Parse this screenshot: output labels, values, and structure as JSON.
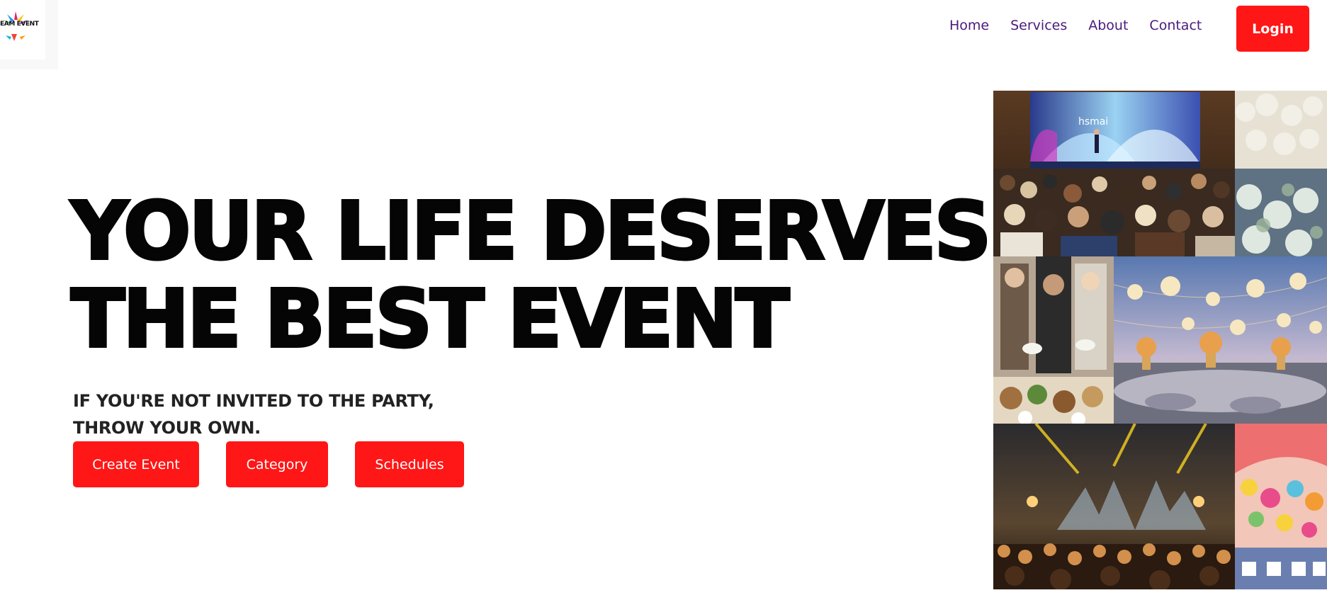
{
  "logo": {
    "text": "EAM EVENT"
  },
  "nav": {
    "items": [
      {
        "label": "Home"
      },
      {
        "label": "Services"
      },
      {
        "label": "About"
      },
      {
        "label": "Contact"
      }
    ],
    "login_label": "Login"
  },
  "hero": {
    "title_line1": "YOUR LIFE DESERVES",
    "title_line2": "THE BEST EVENT",
    "subtitle_line1": "IF YOU'RE NOT INVITED TO THE PARTY,",
    "subtitle_line2": "THROW YOUR OWN.",
    "buttons": [
      {
        "label": "Create Event"
      },
      {
        "label": "Category"
      },
      {
        "label": "Schedules"
      }
    ]
  },
  "collage": {
    "conference_banner": "hsmai"
  },
  "colors": {
    "accent": "#ff1616",
    "nav_text": "#4a1a7c",
    "title": "#050505"
  }
}
